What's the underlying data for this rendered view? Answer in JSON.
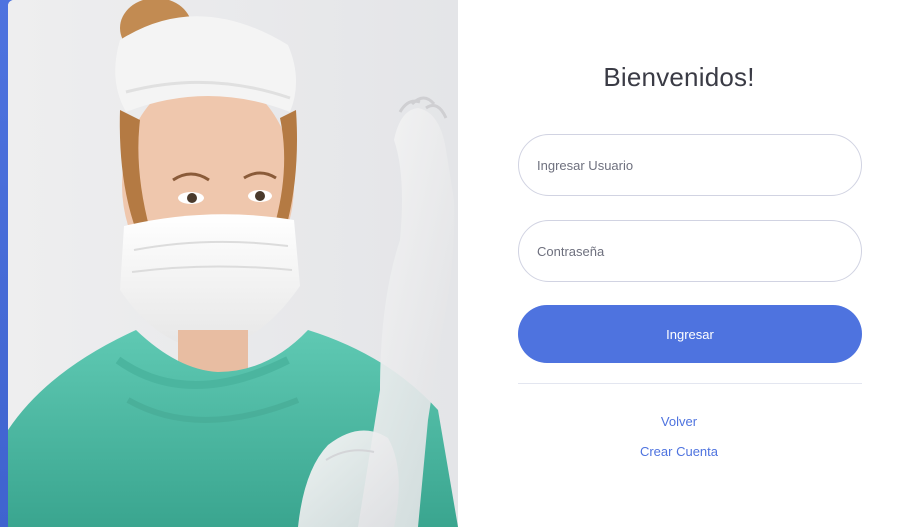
{
  "login": {
    "welcome": "Bienvenidos!",
    "user_placeholder": "Ingresar Usuario",
    "password_placeholder": "Contraseña",
    "submit_label": "Ingresar",
    "back_link": "Volver",
    "create_account_link": "Crear Cuenta"
  },
  "photo": {
    "subject": "medical-professional-photo"
  },
  "colors": {
    "accent": "#4e73df",
    "background": "#4e73df",
    "card": "#ffffff",
    "text": "#3a3b45",
    "muted": "#6e707e",
    "border": "#d1d3e2"
  }
}
